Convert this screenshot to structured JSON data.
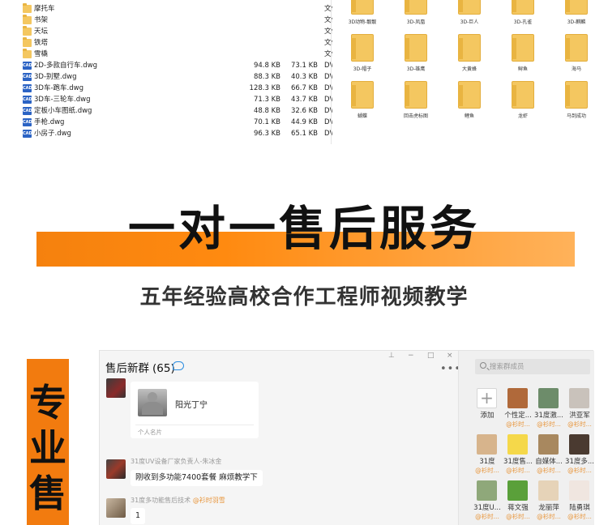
{
  "file_list": [
    {
      "name": "摩托车",
      "size": "",
      "csize": "",
      "type": "文件夹",
      "kind": "folder"
    },
    {
      "name": "书架",
      "size": "",
      "csize": "",
      "type": "文件夹",
      "kind": "folder"
    },
    {
      "name": "天坛",
      "size": "",
      "csize": "",
      "type": "文件夹",
      "kind": "folder"
    },
    {
      "name": "铁塔",
      "size": "",
      "csize": "",
      "type": "文件夹",
      "kind": "folder"
    },
    {
      "name": "雪橇",
      "size": "",
      "csize": "",
      "type": "文件夹",
      "kind": "folder"
    },
    {
      "name": "2D-多款自行车.dwg",
      "size": "94.8 KB",
      "csize": "73.1 KB",
      "type": "DWG 文",
      "kind": "cad"
    },
    {
      "name": "3D-别墅.dwg",
      "size": "88.3 KB",
      "csize": "40.3 KB",
      "type": "DWG 文",
      "kind": "cad"
    },
    {
      "name": "3D车-跑车.dwg",
      "size": "128.3 KB",
      "csize": "66.7 KB",
      "type": "DWG 文",
      "kind": "cad"
    },
    {
      "name": "3D车-三轮车.dwg",
      "size": "71.3 KB",
      "csize": "43.7 KB",
      "type": "DWG 文",
      "kind": "cad"
    },
    {
      "name": "定板小车图纸.dwg",
      "size": "48.8 KB",
      "csize": "32.6 KB",
      "type": "DWG 文",
      "kind": "cad"
    },
    {
      "name": "手枪.dwg",
      "size": "70.1 KB",
      "csize": "44.9 KB",
      "type": "DWG 文",
      "kind": "cad"
    },
    {
      "name": "小房子.dwg",
      "size": "96.3 KB",
      "csize": "65.1 KB",
      "type": "DWG 文",
      "kind": "cad"
    }
  ],
  "cad_icon_text": "CAD",
  "thumbnails": [
    [
      "3D动物-靓靓",
      "3D-凤凰",
      "3D-巨人",
      "3D-孔雀",
      "3D-麒麟"
    ],
    [
      "3D-帽子",
      "3D-雄鹰",
      "大黄蜂",
      "鲟鱼",
      "海马"
    ],
    [
      "蝴蝶",
      "回击虎标图",
      "鲤鱼",
      "龙虾",
      "马到成功"
    ]
  ],
  "banner": {
    "title": "一对一售后服务",
    "subtitle": "五年经验高校合作工程师视频教学"
  },
  "side_tag": [
    "专",
    "业",
    "售"
  ],
  "chat": {
    "group_name": "售后新群",
    "member_count": "(65)",
    "window_controls": [
      "⊥",
      "−",
      "□",
      "×"
    ],
    "more": "•••",
    "card_name": "阳光丁宁",
    "card_footer": "个人名片",
    "messages": [
      {
        "sender": "31度UV设备厂家负责人-朱冰金",
        "mention": "",
        "text": "刚收到多功能7400套餐  麻烦教学下"
      },
      {
        "sender": "31度多功能售后技术",
        "mention": "@衫时羽雪",
        "text": "1"
      }
    ],
    "search_placeholder": "搜索群成员",
    "members": [
      {
        "name": "添加",
        "tag": "",
        "color": "#ffffff",
        "add": true
      },
      {
        "name": "个性定...",
        "tag": "@衫时...",
        "color": "#b0693a"
      },
      {
        "name": "31度激...",
        "tag": "@衫时...",
        "color": "#6d8c6a"
      },
      {
        "name": "洪亚军",
        "tag": "@衫时...",
        "color": "#c9c2bb"
      },
      {
        "name": "31度",
        "tag": "@衫时...",
        "color": "#d7b48c"
      },
      {
        "name": "31度售...",
        "tag": "@衫时...",
        "color": "#f5d84a"
      },
      {
        "name": "自媒体...",
        "tag": "@衫时...",
        "color": "#a8885f"
      },
      {
        "name": "31度多...",
        "tag": "@衫时...",
        "color": "#4a3a30"
      },
      {
        "name": "31度U...",
        "tag": "@衫时...",
        "color": "#8fa87a"
      },
      {
        "name": "蒋文强",
        "tag": "@衫时...",
        "color": "#5aa03a"
      },
      {
        "name": "龙丽萍",
        "tag": "@衫时...",
        "color": "#e6d3b8"
      },
      {
        "name": "陆勇琪",
        "tag": "@衫时...",
        "color": "#f0e6e0"
      }
    ]
  }
}
